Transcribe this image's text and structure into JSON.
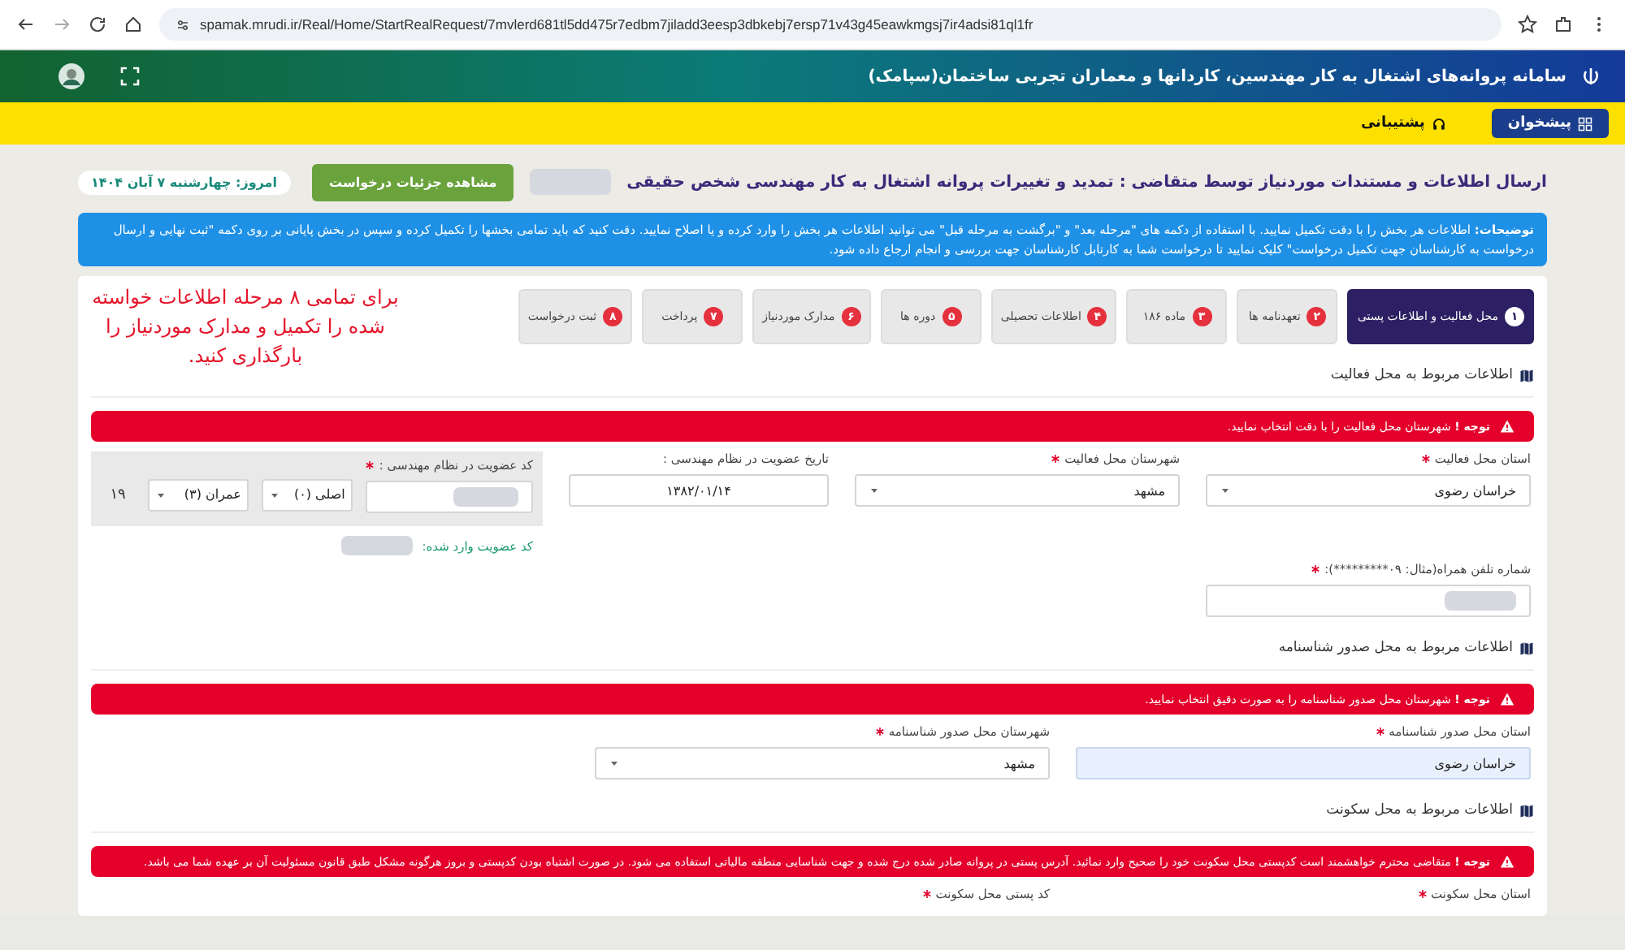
{
  "browser": {
    "url": "spamak.mrudi.ir/Real/Home/StartRealRequest/7mvlerd681tl5dd475r7edbm7jiladd3eesp3dbkebj7ersp71v43g45eawkmgsj7ir4adsi81ql1fr"
  },
  "header": {
    "title": "سامانه پروانه‌های اشتغال به کار مهندسین، کاردانها و معماران تجربی ساختمان(سپامک)"
  },
  "nav": [
    {
      "label": "پیشخوان",
      "selected": true
    },
    {
      "label": "پشتیبانی",
      "selected": false
    }
  ],
  "page": {
    "title": "ارسال اطلاعات و مستندات موردنیاز توسط متقاضی : تمدید و تغییرات پروانه اشتغال به کار مهندسی شخص حقیقی",
    "details_button": "مشاهده جزئیات درخواست",
    "date": "امروز: چهارشنبه ۷ آبان ۱۴۰۴"
  },
  "info": "**توضیحات:** اطلاعات هر بخش را با دقت تکمیل نمایید. با استفاده از دکمه های \"مرحله بعد\" و \"برگشت به مرحله قبل\" می توانید اطلاعات هر بخش را وارد کرده و یا اصلاح نمایید. دقت کنید که باید تمامی بخشها را تکمیل کرده و سپس در بخش پایانی بر روی دکمه \"ثبت نهایی و ارسال درخواست به کارشناسان جهت تکمیل درخواست\" کلیک نمایید تا درخواست شما به کارتابل کارشناسان جهت بررسی و انجام ارجاع داده شود.",
  "steps": [
    {
      "number": "۱",
      "label": "محل فعالیت و اطلاعات پستی",
      "selected": true
    },
    {
      "number": "۲",
      "label": "تعهدنامه ها",
      "selected": false
    },
    {
      "number": "۳",
      "label": "ماده ۱۸۶",
      "selected": false
    },
    {
      "number": "۴",
      "label": "اطلاعات تحصیلی",
      "selected": false
    },
    {
      "number": "۵",
      "label": "دوره ها",
      "selected": false
    },
    {
      "number": "۶",
      "label": "مدارک موردنیاز",
      "selected": false
    },
    {
      "number": "۷",
      "label": "پرداخت",
      "selected": false
    },
    {
      "number": "۸",
      "label": "ثبت درخواست",
      "selected": false
    }
  ],
  "annotation": "برای تمامی ۸ مرحله اطلاعات خواسته شده را تکمیل و مدارک موردنیاز را بارگذاری کنید.",
  "sections": [
    {
      "title": "اطلاعات مربوط به محل فعالیت",
      "alert": "**توجه !** شهرستان محل فعالیت را با دقت انتخاب نمایید.",
      "fields": [
        {
          "kind": "select",
          "label": "استان محل فعالیت",
          "required": true,
          "value": "خراسان رضوی"
        },
        {
          "kind": "select",
          "label": "شهرستان محل فعالیت",
          "required": true,
          "value": "مشهد"
        },
        {
          "kind": "input",
          "label": "تاریخ عضویت در نظام مهندسی :",
          "required": false,
          "value": "۱۳۸۲/۰۱/۱۴"
        },
        {
          "kind": "membership",
          "label": "کد عضویت در نظام مهندسی :",
          "required": true,
          "type_value": "اصلی (۰)",
          "field_value": "عمران (۳)",
          "code": "۱۹",
          "entered_label": "کد عضویت وارد شده:"
        }
      ],
      "extra_fields": [
        {
          "kind": "masked",
          "label": "شماره تلفن همراه(مثال: ۰۹*********):",
          "required": true
        }
      ]
    },
    {
      "title": "اطلاعات مربوط به محل صدور شناسنامه",
      "alert": "**توجه !** شهرستان محل صدور شناسنامه را به صورت دقیق انتخاب نمایید.",
      "fields": [
        {
          "kind": "readonly",
          "label": "استان محل صدور شناسنامه",
          "required": true,
          "value": "خراسان رضوی"
        },
        {
          "kind": "select",
          "label": "شهرستان محل صدور شناسنامه",
          "required": true,
          "value": "مشهد"
        }
      ]
    },
    {
      "title": "اطلاعات مربوط به محل سکونت",
      "alert": "**توجه !** متقاضی محترم خواهشمند است کدپستی محل سکونت خود را صحیح وارد نمائید. آدرس پستی در پروانه صادر شده درج شده و جهت شناسایی منطقه مالیاتی استفاده می شود. در صورت اشتباه بودن کدپستی و بروز هرگونه مشکل طبق قانون مسئولیت آن بر عهده شما می باشد.",
      "fields": [
        {
          "kind": "label",
          "label": "استان محل سکونت",
          "required": true
        },
        {
          "kind": "label",
          "label": "کد پستی محل سکونت",
          "required": true
        }
      ]
    }
  ]
}
